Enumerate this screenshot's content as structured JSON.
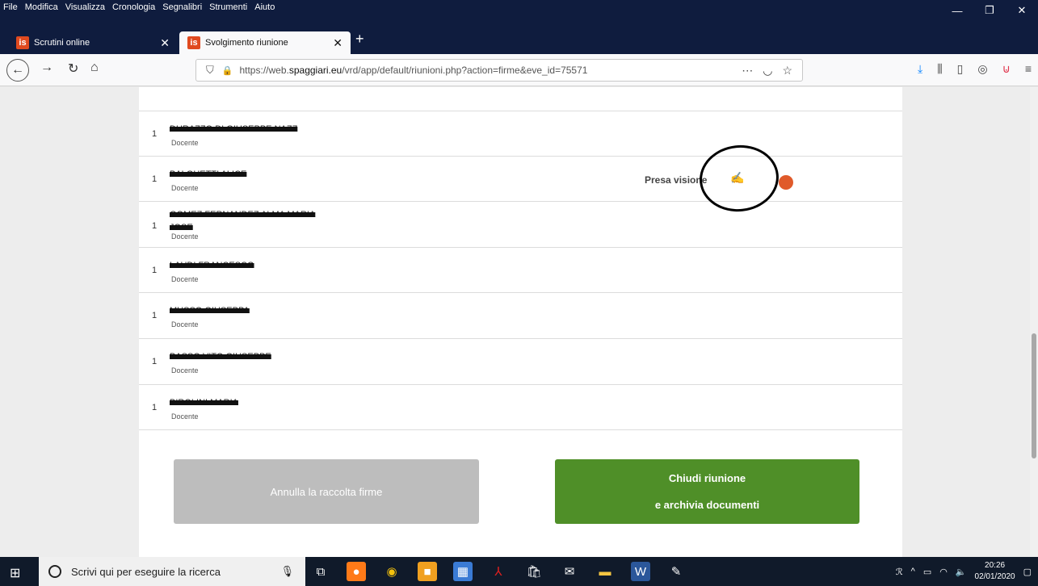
{
  "menu": [
    "File",
    "Modifica",
    "Visualizza",
    "Cronologia",
    "Segnalibri",
    "Strumenti",
    "Aiuto"
  ],
  "window_controls": {
    "minimize": "—",
    "restore": "❐",
    "close": "✕"
  },
  "tabs": [
    {
      "label": "Scrutini online",
      "favicon": "is"
    },
    {
      "label": "Svolgimento riunione",
      "favicon": "is"
    }
  ],
  "address": {
    "prefix": "https://web.",
    "domain": "spaggiari.eu",
    "path": "/vrd/app/default/riunioni.php?action=firme&eve_id=75571"
  },
  "rows": [
    {
      "num": "1",
      "name": "DURAZZO DI GIUSEPPE NAZZ",
      "role": "Docente"
    },
    {
      "num": "1",
      "name": "BALGHETTI ALICE",
      "role": "Docente",
      "status": "Presa visione"
    },
    {
      "num": "1",
      "name": "GOMEZ FERNANDEZ ALMA MARIA",
      "name2": "JOSE",
      "role": "Docente"
    },
    {
      "num": "1",
      "name": "LAUDI FRANCESCO",
      "role": "Docente"
    },
    {
      "num": "1",
      "name": "MUSSO GIUSEPPA",
      "role": "Docente"
    },
    {
      "num": "1",
      "name": "BASSO VITO GIUSEPPE",
      "role": "Docente"
    },
    {
      "num": "1",
      "name": "BIROLINI MARIA",
      "role": "Docente"
    }
  ],
  "buttons": {
    "cancel": "Annulla la raccolta firme",
    "close_line1": "Chiudi riunione",
    "close_line2": "e archivia documenti"
  },
  "taskbar": {
    "search_placeholder": "Scrivi qui per eseguire la ricerca",
    "time": "20:26",
    "date": "02/01/2020"
  },
  "colors": {
    "accent_green": "#4f8f28",
    "status_dot": "#e05a2a",
    "titlebar": "#0f1c3e"
  }
}
